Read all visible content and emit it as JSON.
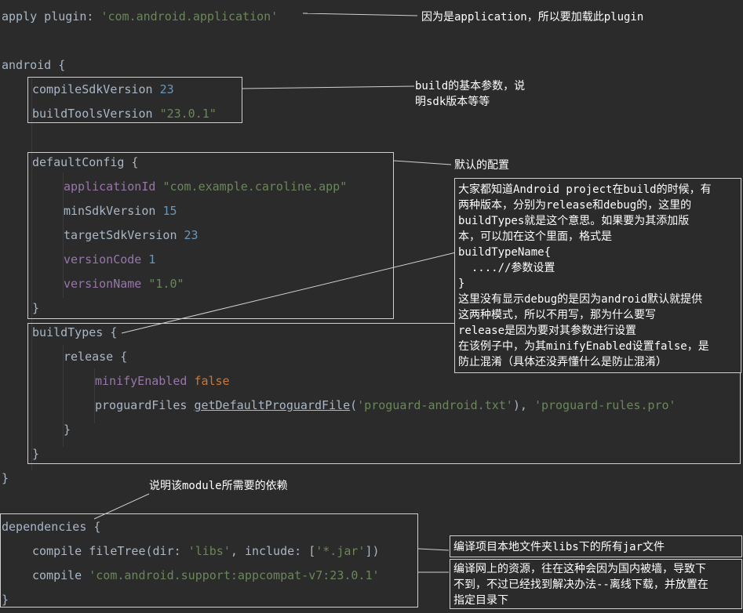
{
  "code": {
    "apply_plugin": {
      "key": "apply plugin",
      "sep": ": ",
      "value": "'com.android.application'"
    },
    "android_open": "android {",
    "compileSdk": {
      "key": "compileSdkVersion",
      "value": "23"
    },
    "buildTools": {
      "key": "buildToolsVersion",
      "value": "\"23.0.1\""
    },
    "default_open": "defaultConfig {",
    "appId": {
      "key": "applicationId",
      "value": "\"com.example.caroline.app\""
    },
    "minSdk": {
      "key": "minSdkVersion",
      "value": "15"
    },
    "targetSdk": {
      "key": "targetSdkVersion",
      "value": "23"
    },
    "versionCode": {
      "key": "versionCode",
      "value": "1"
    },
    "versionName": {
      "key": "versionName",
      "value": "\"1.0\""
    },
    "close_brace": "}",
    "buildtypes_open": "buildTypes {",
    "release_open": "release {",
    "minify": {
      "key": "minifyEnabled",
      "value": "false"
    },
    "proguard": {
      "key": "proguardFiles",
      "fn": "getDefaultProguardFile",
      "open": "(",
      "arg1": "'proguard-android.txt'",
      "mid": "), ",
      "arg2": "'proguard-rules.pro'"
    },
    "deps_open": "dependencies {",
    "compile1": {
      "key": "compile",
      "fn": "fileTree(",
      "dir_key": "dir",
      "colon": ": ",
      "dir_val": "'libs'",
      "comma": ", ",
      "inc_key": "include",
      "inc_colon": ": ",
      "inc_open": "[",
      "inc_val": "'*.jar'",
      "inc_close": "])"
    },
    "compile2": {
      "key": "compile",
      "value": "'com.android.support:appcompat-v7:23.0.1'"
    }
  },
  "notes": {
    "plugin": "因为是application，所以要加载此plugin",
    "build_params_1": "build的基本参数，说",
    "build_params_2": "明sdk版本等等",
    "default_config": "默认的配置",
    "buildtypes": [
      "大家都知道Android project在build的时候，有",
      "两种版本，分别为release和debug的，这里的",
      "buildTypes就是这个意思。如果要为其添加版",
      "本，可以加在这个里面，格式是",
      "buildTypeName{",
      "  ....//参数设置",
      "}",
      "这里没有显示debug的是因为android默认就提供",
      "这两种模式，所以不用写，那为什么要写"
    ],
    "release_note": [
      "release是因为要对其参数进行设置",
      "在该例子中，为其minifyEnabled设置false，是",
      "防止混淆（具体还没弄懂什么是防止混淆）"
    ],
    "module_deps": "说明该module所需要的依赖",
    "local_jar": "编译项目本地文件夹libs下的所有jar文件",
    "remote": [
      "编译网上的资源，往在这种会因为国内被墙，导致下",
      "不到，不过已经找到解决办法--离线下载，并放置在",
      "指定目录下"
    ]
  },
  "colors": {
    "background": "#2b2b2b",
    "keyword": "#cc7832",
    "string": "#6a8759",
    "number": "#6897bb",
    "property": "#9876aa",
    "text": "#a9b7c6"
  }
}
